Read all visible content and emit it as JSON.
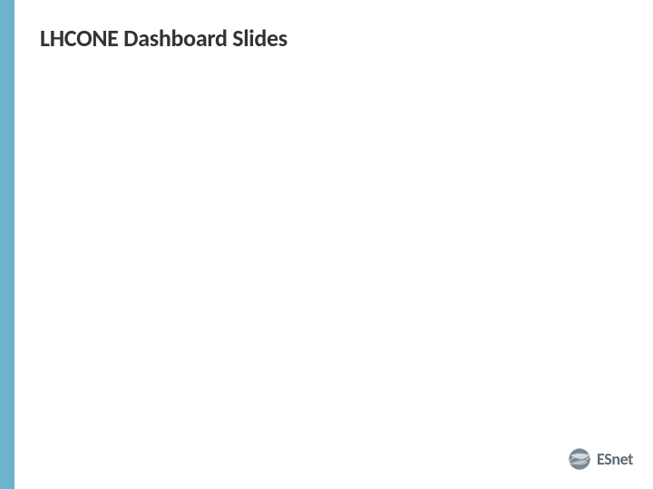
{
  "slide": {
    "title": "LHCONE Dashboard Slides"
  },
  "branding": {
    "logo_name": "ESnet",
    "logo_icon_name": "esnet-globe-icon",
    "accent_color": "#6cb3cd"
  }
}
